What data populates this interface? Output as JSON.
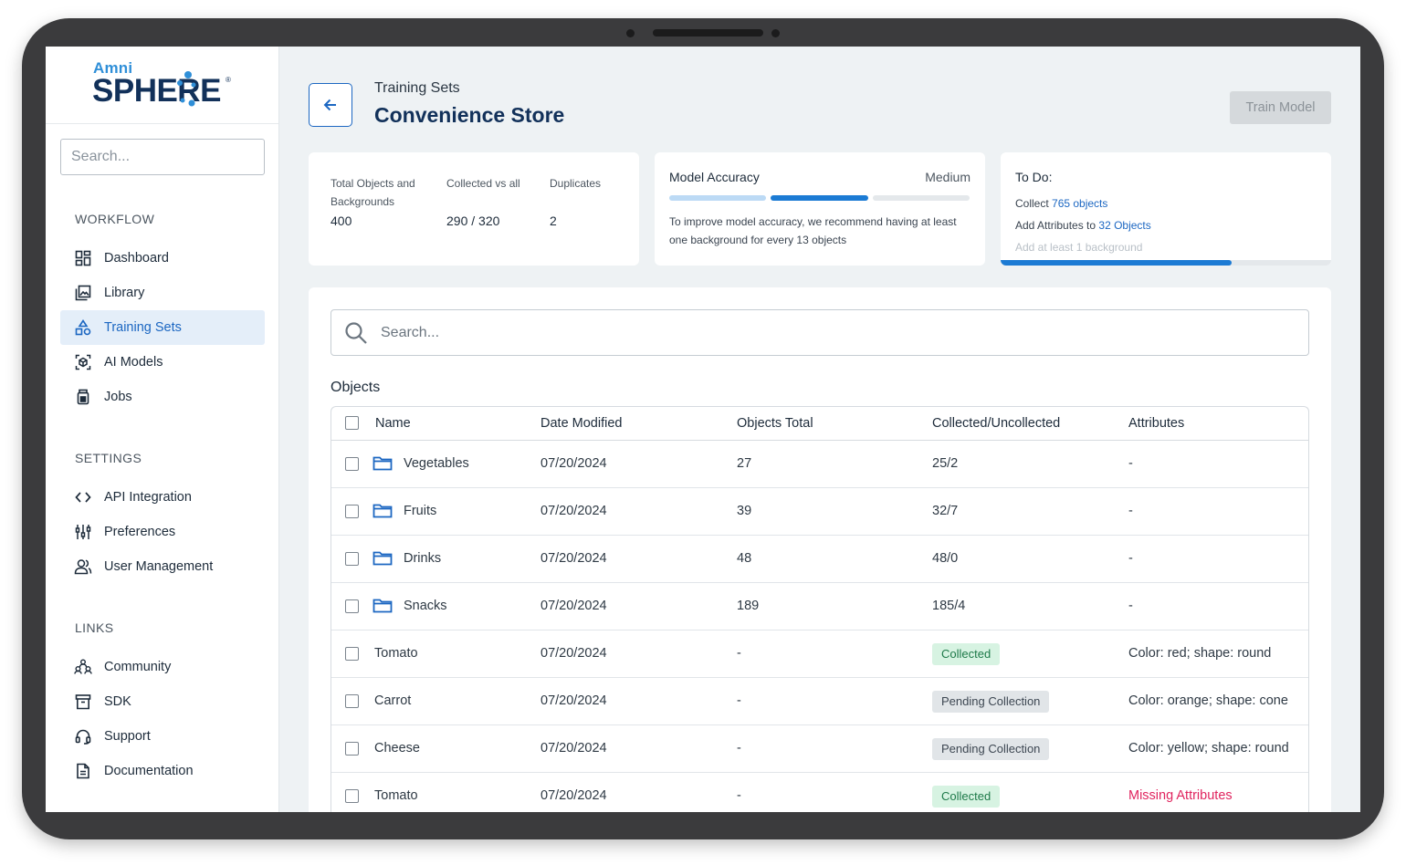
{
  "logo": {
    "top": "Amni",
    "main": "SPHERE",
    "reg": "®"
  },
  "sidebar": {
    "search_placeholder": "Search...",
    "sections": {
      "workflow": "WORKFLOW",
      "settings": "SETTINGS",
      "links": "LINKS"
    },
    "items": {
      "dashboard": "Dashboard",
      "library": "Library",
      "training_sets": "Training Sets",
      "ai_models": "AI Models",
      "jobs": "Jobs",
      "api_integration": "API Integration",
      "preferences": "Preferences",
      "user_management": "User Management",
      "community": "Community",
      "sdk": "SDK",
      "support": "Support",
      "documentation": "Documentation"
    },
    "active": "training_sets"
  },
  "header": {
    "breadcrumb": "Training Sets",
    "title": "Convenience Store",
    "train_button": "Train Model"
  },
  "stats": {
    "total_label": "Total Objects and Backgrounds",
    "total_value": "400",
    "collected_label": "Collected vs all",
    "collected_value": "290 / 320",
    "duplicates_label": "Duplicates",
    "duplicates_value": "2"
  },
  "accuracy": {
    "title": "Model Accuracy",
    "level": "Medium",
    "segments_filled": 2,
    "segments_total": 3,
    "text": "To improve model accuracy, we recommend having at least one background for every 13 objects"
  },
  "todo": {
    "title": "To Do:",
    "line1_prefix": "Collect ",
    "line1_link": "765 objects",
    "line2_prefix": "Add Attributes to ",
    "line2_link": "32 Objects",
    "line3": "Add at least 1 background",
    "progress": 0.7
  },
  "main": {
    "search_placeholder": "Search...",
    "objects_title": "Objects",
    "columns": {
      "name": "Name",
      "date": "Date Modified",
      "total": "Objects Total",
      "collected": "Collected/Uncollected",
      "attributes": "Attributes"
    },
    "rows": [
      {
        "name": "Vegetables",
        "folder": true,
        "date": "07/20/2024",
        "total": "27",
        "collected": "25/2",
        "attributes": "-"
      },
      {
        "name": "Fruits",
        "folder": true,
        "date": "07/20/2024",
        "total": "39",
        "collected": "32/7",
        "attributes": "-"
      },
      {
        "name": "Drinks",
        "folder": true,
        "date": "07/20/2024",
        "total": "48",
        "collected": "48/0",
        "attributes": "-"
      },
      {
        "name": "Snacks",
        "folder": true,
        "date": "07/20/2024",
        "total": "189",
        "collected": "185/4",
        "attributes": "-"
      },
      {
        "name": "Tomato",
        "folder": false,
        "date": "07/20/2024",
        "total": "-",
        "status": "Collected",
        "attributes": "Color: red; shape: round"
      },
      {
        "name": "Carrot",
        "folder": false,
        "date": "07/20/2024",
        "total": "-",
        "status": "Pending Collection",
        "attributes": "Color: orange; shape: cone"
      },
      {
        "name": "Cheese",
        "folder": false,
        "date": "07/20/2024",
        "total": "-",
        "status": "Pending Collection",
        "attributes": "Color: yellow; shape: round"
      },
      {
        "name": "Tomato",
        "folder": false,
        "date": "07/20/2024",
        "total": "-",
        "status": "Collected",
        "attributes": "Missing Attributes",
        "attributes_missing": true
      }
    ]
  },
  "colors": {
    "accent": "#1c67c2",
    "brand_dark": "#12315a",
    "collected_bg": "#d7f3e2",
    "pending_bg": "#e1e5e8",
    "missing": "#e0245e"
  }
}
